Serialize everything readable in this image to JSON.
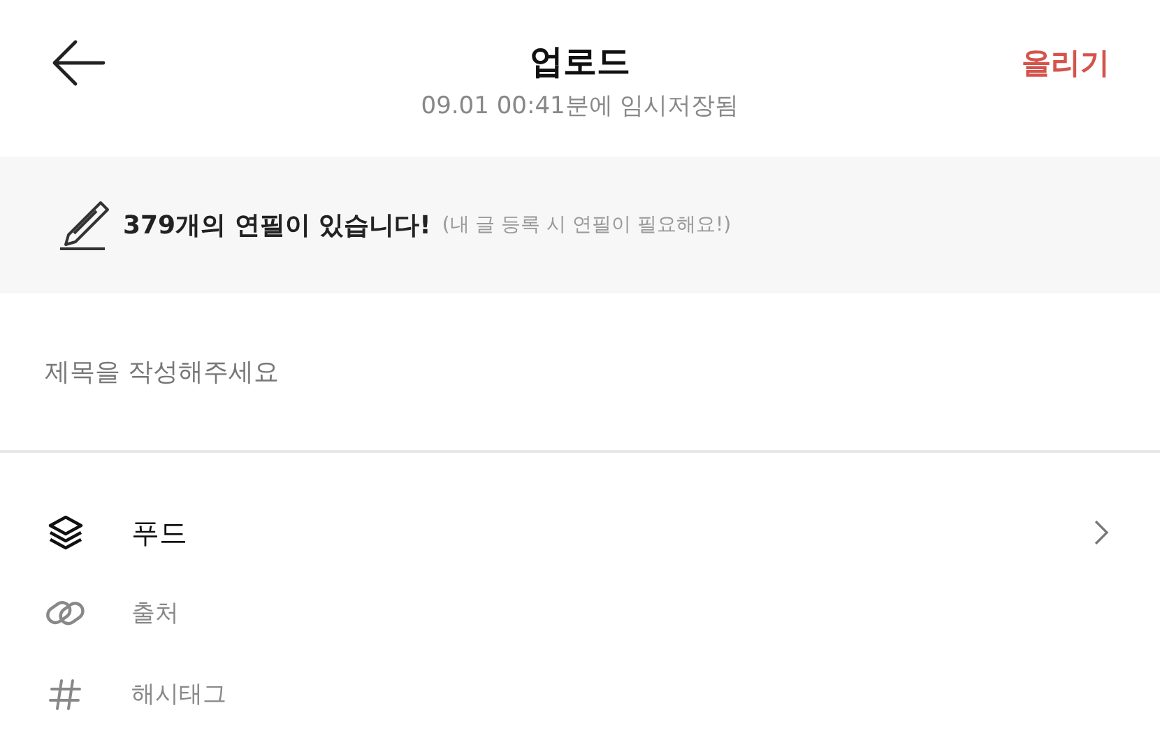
{
  "header": {
    "title": "업로드",
    "subtitle": "09.01 00:41분에 임시저장됨",
    "action": "올리기"
  },
  "banner": {
    "message": "379개의 연필이 있습니다!",
    "note": "(내 글 등록 시 연필이 필요해요!)"
  },
  "title_field": {
    "placeholder": "제목을 작성해주세요"
  },
  "options": [
    {
      "kind": "select",
      "value": "푸드"
    },
    {
      "kind": "input",
      "placeholder": "출처"
    },
    {
      "kind": "input",
      "placeholder": "해시태그"
    }
  ]
}
